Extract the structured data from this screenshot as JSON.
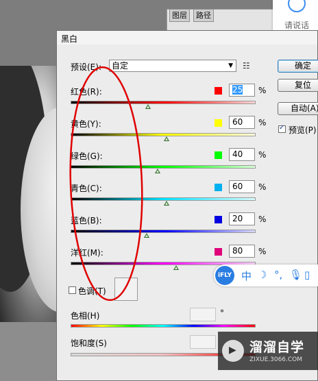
{
  "background_tabs": [
    "图层",
    "路径"
  ],
  "voice_widget": {
    "label": "请说话",
    "icon": "microphone-icon"
  },
  "dialog": {
    "title": "黑白",
    "preset": {
      "label": "预设(E):",
      "value": "自定",
      "menu_icon": "list-menu-icon"
    },
    "buttons": {
      "ok": "确定",
      "reset": "复位",
      "auto": "自动(A)"
    },
    "preview": {
      "label": "预览(P)",
      "checked": true
    },
    "channels": [
      {
        "key": "red",
        "label": "红色(R):",
        "value": "25",
        "color": "#ff0000",
        "grad": "linear-gradient(to right,#000,#ff0000,#ffd6d6)",
        "level": 0.42,
        "selected": true
      },
      {
        "key": "yellow",
        "label": "黄色(Y):",
        "value": "60",
        "color": "#ffff00",
        "grad": "linear-gradient(to right,#000,#ffff00,#ffffe0)",
        "level": 0.52,
        "selected": false
      },
      {
        "key": "green",
        "label": "绿色(G):",
        "value": "40",
        "color": "#00ff00",
        "grad": "linear-gradient(to right,#000,#00ff00,#d9ffd9)",
        "level": 0.47,
        "selected": false
      },
      {
        "key": "cyan",
        "label": "青色(C):",
        "value": "60",
        "color": "#00b0f0",
        "grad": "linear-gradient(to right,#000,#00e5ff,#d9fbff)",
        "level": 0.52,
        "selected": false
      },
      {
        "key": "blue",
        "label": "蓝色(B):",
        "value": "20",
        "color": "#0000e0",
        "grad": "linear-gradient(to right,#000,#0000ff,#d9d9ff)",
        "level": 0.41,
        "selected": false
      },
      {
        "key": "magenta",
        "label": "洋红(M):",
        "value": "80",
        "color": "#e0007a",
        "grad": "linear-gradient(to right,#000,#ff00ff,#ffd9ff)",
        "level": 0.57,
        "selected": false
      }
    ],
    "pct": "%",
    "tint": {
      "label": "色调(T)",
      "checked": false
    },
    "hue": {
      "label": "色相(H)",
      "unit": "°",
      "grad": "linear-gradient(to right,#ff0000,#ffff00,#00ff00,#00ffff,#0000ff,#ff00ff,#ff0000)"
    },
    "saturation": {
      "label": "饱和度(S)",
      "grad": "linear-gradient(to right,#d9d9d9,#f4c0c0,#ff0000)"
    }
  },
  "ifly_toolbar": {
    "logo": "iFLY",
    "items": [
      "中",
      "☽",
      "°,",
      "mic",
      "kb"
    ]
  },
  "watermark": {
    "name": "溜溜自学",
    "url": "ZIXUE.3066.COM"
  },
  "colors": {
    "annotation": "#e00000",
    "dialog_bg": "#ececec",
    "accent": "#3399ff"
  }
}
